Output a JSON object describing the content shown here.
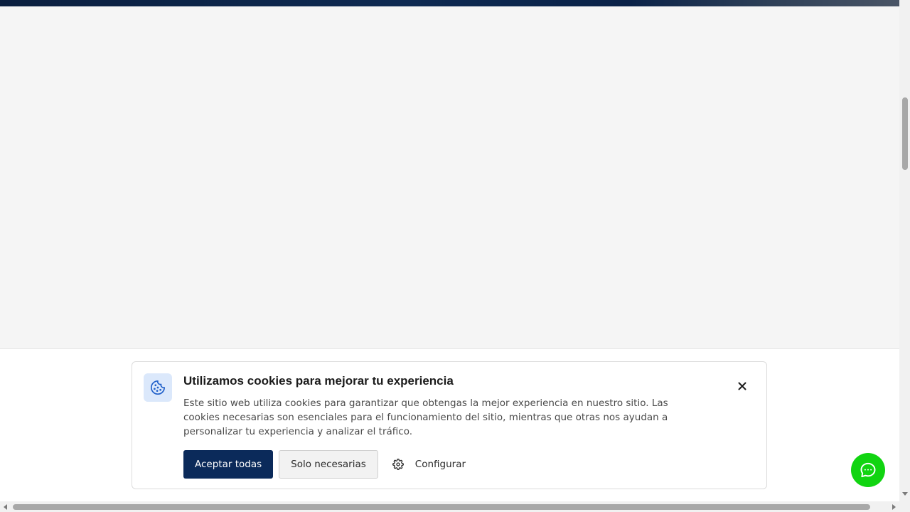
{
  "cookie_banner": {
    "title": "Utilizamos cookies para mejorar tu experiencia",
    "description": "Este sitio web utiliza cookies para garantizar que obtengas la mejor experiencia en nuestro sitio. Las cookies necesarias son esenciales para el funcionamiento del sitio, mientras que otras nos ayudan a personalizar tu experiencia y analizar el tráfico.",
    "accept_all_label": "Aceptar todas",
    "necessary_only_label": "Solo necesarias",
    "configure_label": "Configurar",
    "icon": "cookie-icon",
    "close_icon": "close-icon",
    "configure_icon": "gear-icon"
  },
  "chat": {
    "icon": "chat-bubble-icon"
  },
  "colors": {
    "primary_button": "#0b2a5a",
    "icon_box_bg": "#dbe8fb",
    "chat_fab": "#11d411",
    "page_bg": "#f5f5f5"
  }
}
